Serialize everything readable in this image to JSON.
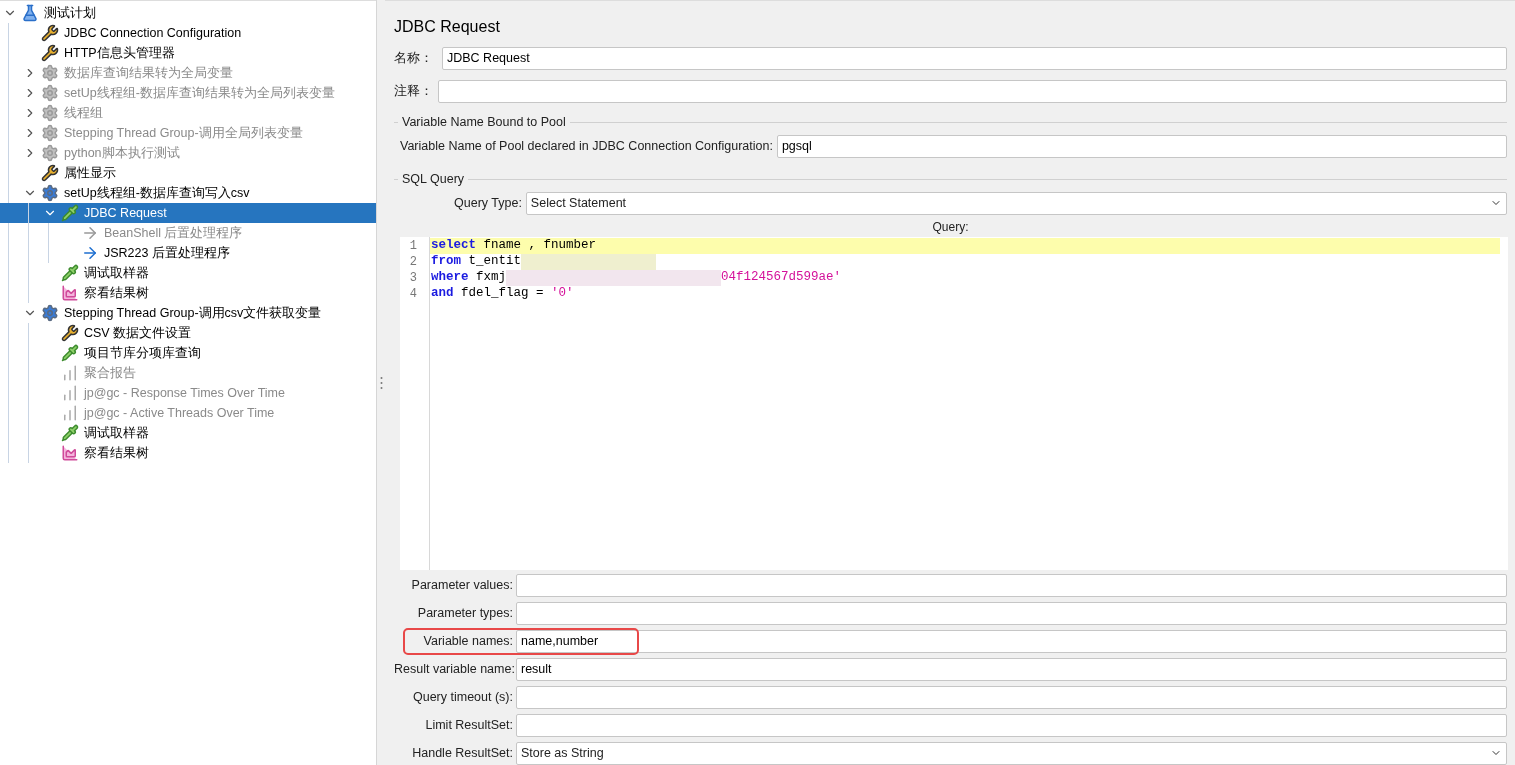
{
  "tree": [
    {
      "label": "测试计划",
      "kind": "flask",
      "expanded": true,
      "disabled": false,
      "selected": false,
      "children": [
        {
          "label": "JDBC Connection Configuration",
          "kind": "tools",
          "disabled": false,
          "selected": false
        },
        {
          "label": "HTTP信息头管理器",
          "kind": "tools",
          "disabled": false,
          "selected": false
        },
        {
          "label": "数据库查询结果转为全局变量",
          "kind": "gear",
          "expanded": false,
          "disabled": true,
          "selected": false
        },
        {
          "label": "setUp线程组-数据库查询结果转为全局列表变量",
          "kind": "gear",
          "expanded": false,
          "disabled": true,
          "selected": false
        },
        {
          "label": "线程组",
          "kind": "gear",
          "expanded": false,
          "disabled": true,
          "selected": false
        },
        {
          "label": "Stepping Thread Group-调用全局列表变量",
          "kind": "gear",
          "expanded": false,
          "disabled": true,
          "selected": false
        },
        {
          "label": "python脚本执行测试",
          "kind": "gear",
          "expanded": false,
          "disabled": true,
          "selected": false
        },
        {
          "label": "属性显示",
          "kind": "tools",
          "disabled": false,
          "selected": false
        },
        {
          "label": "setUp线程组-数据库查询写入csv",
          "kind": "thread",
          "expanded": true,
          "disabled": false,
          "selected": false,
          "children": [
            {
              "label": "JDBC Request",
              "kind": "sampler",
              "expanded": true,
              "disabled": false,
              "selected": true,
              "children": [
                {
                  "label": "BeanShell 后置处理程序",
                  "kind": "post",
                  "disabled": true,
                  "selected": false
                },
                {
                  "label": "JSR223 后置处理程序",
                  "kind": "script",
                  "disabled": false,
                  "selected": false
                }
              ]
            },
            {
              "label": "调试取样器",
              "kind": "sampler",
              "disabled": false,
              "selected": false
            },
            {
              "label": "察看结果树",
              "kind": "graph",
              "disabled": false,
              "selected": false
            }
          ]
        },
        {
          "label": "Stepping Thread Group-调用csv文件获取变量",
          "kind": "thread",
          "expanded": true,
          "disabled": false,
          "selected": false,
          "children": [
            {
              "label": "CSV 数据文件设置",
              "kind": "tools",
              "disabled": false,
              "selected": false
            },
            {
              "label": "项目节库分项库查询",
              "kind": "sampler",
              "disabled": false,
              "selected": false
            },
            {
              "label": "聚合报告",
              "kind": "report",
              "disabled": true,
              "selected": false
            },
            {
              "label": "jp@gc - Response Times Over Time",
              "kind": "report",
              "disabled": true,
              "selected": false
            },
            {
              "label": "jp@gc - Active Threads Over Time",
              "kind": "report",
              "disabled": true,
              "selected": false
            },
            {
              "label": "调试取样器",
              "kind": "sampler",
              "disabled": false,
              "selected": false
            },
            {
              "label": "察看结果树",
              "kind": "graph",
              "disabled": false,
              "selected": false
            }
          ]
        }
      ]
    }
  ],
  "panel": {
    "title": "JDBC Request",
    "name": {
      "label": "名称：",
      "value": "JDBC Request"
    },
    "comment": {
      "label": "注释："
    },
    "pool_group": {
      "title": "Variable Name Bound to Pool",
      "label": "Variable Name of Pool declared in JDBC Connection Configuration:",
      "value": "pgsql"
    },
    "sql_group": {
      "title": "SQL Query",
      "query_type": {
        "label": "Query Type:",
        "value": "Select Statement"
      },
      "query_label": "Query:",
      "lines": [
        {
          "number": "1",
          "current": true,
          "tokens": [
            {
              "kind": "keyword",
              "text": "select"
            },
            {
              "kind": "plain",
              "text": " fname , fnumber"
            }
          ]
        },
        {
          "number": "2",
          "current": false,
          "tokens": [
            {
              "kind": "keyword",
              "text": "from"
            },
            {
              "kind": "plain",
              "text": " t_entit"
            },
            {
              "kind": "blur",
              "color": "#efefcf"
            }
          ]
        },
        {
          "number": "3",
          "current": false,
          "tokens": [
            {
              "kind": "keyword",
              "text": "where"
            },
            {
              "kind": "plain",
              "text": " fxmj"
            },
            {
              "kind": "blur",
              "color": "#f2e6ee"
            },
            {
              "kind": "string",
              "text": "04f124567d599ae'"
            }
          ]
        },
        {
          "number": "4",
          "current": false,
          "tokens": [
            {
              "kind": "keyword",
              "text": "and"
            },
            {
              "kind": "plain",
              "text": " fdel_flag = "
            },
            {
              "kind": "string",
              "text": "'0'"
            }
          ]
        }
      ]
    },
    "params": [
      {
        "label": "Parameter values:",
        "kind": "text",
        "highlighted": false
      },
      {
        "label": "Parameter types:",
        "kind": "text",
        "highlighted": false
      },
      {
        "label": "Variable names:",
        "value": "name,number",
        "kind": "text",
        "highlighted": true
      },
      {
        "label": "Result variable name:",
        "value": "result",
        "kind": "text",
        "highlighted": false
      },
      {
        "label": "Query timeout (s):",
        "kind": "text",
        "highlighted": false
      },
      {
        "label": "Limit ResultSet:",
        "kind": "text",
        "highlighted": false
      },
      {
        "label": "Handle ResultSet:",
        "value": "Store as String",
        "kind": "select",
        "highlighted": false
      }
    ]
  }
}
